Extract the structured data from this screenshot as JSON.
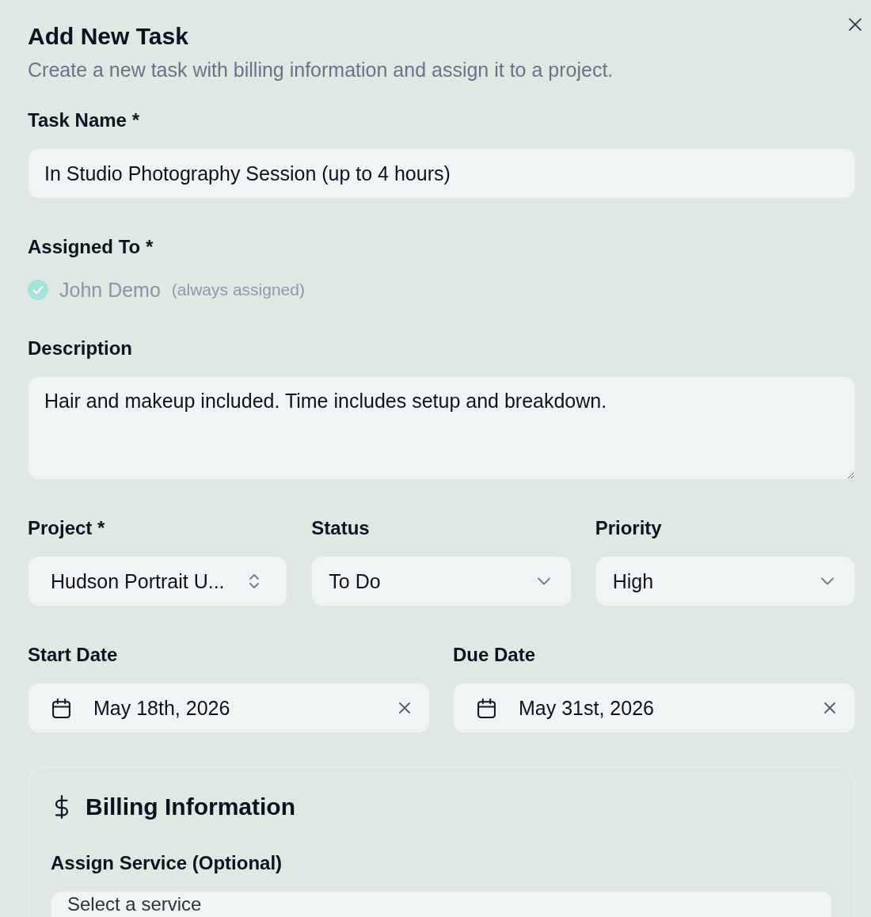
{
  "dialog": {
    "title": "Add New Task",
    "description": "Create a new task with billing information and assign it to a project."
  },
  "task_name": {
    "label": "Task Name *",
    "value": "In Studio Photography Session (up to 4 hours)"
  },
  "assigned_to": {
    "label": "Assigned To *",
    "assignees": [
      {
        "name": "John Demo",
        "note": "(always assigned)",
        "checked": true,
        "disabled": true
      }
    ]
  },
  "description": {
    "label": "Description",
    "value": "Hair and makeup included. Time includes setup and breakdown."
  },
  "selects": [
    {
      "label": "Project *",
      "value": "Hudson Portrait U...",
      "kind": "combobox"
    },
    {
      "label": "Status",
      "value": "To Do",
      "kind": "dropdown"
    },
    {
      "label": "Priority",
      "value": "High",
      "kind": "dropdown"
    }
  ],
  "dates": [
    {
      "label": "Start Date",
      "value": "May 18th, 2026"
    },
    {
      "label": "Due Date",
      "value": "May 31st, 2026"
    }
  ],
  "billing": {
    "title": "Billing Information",
    "service": {
      "label": "Assign Service (Optional)",
      "placeholder": "Select a service"
    }
  }
}
